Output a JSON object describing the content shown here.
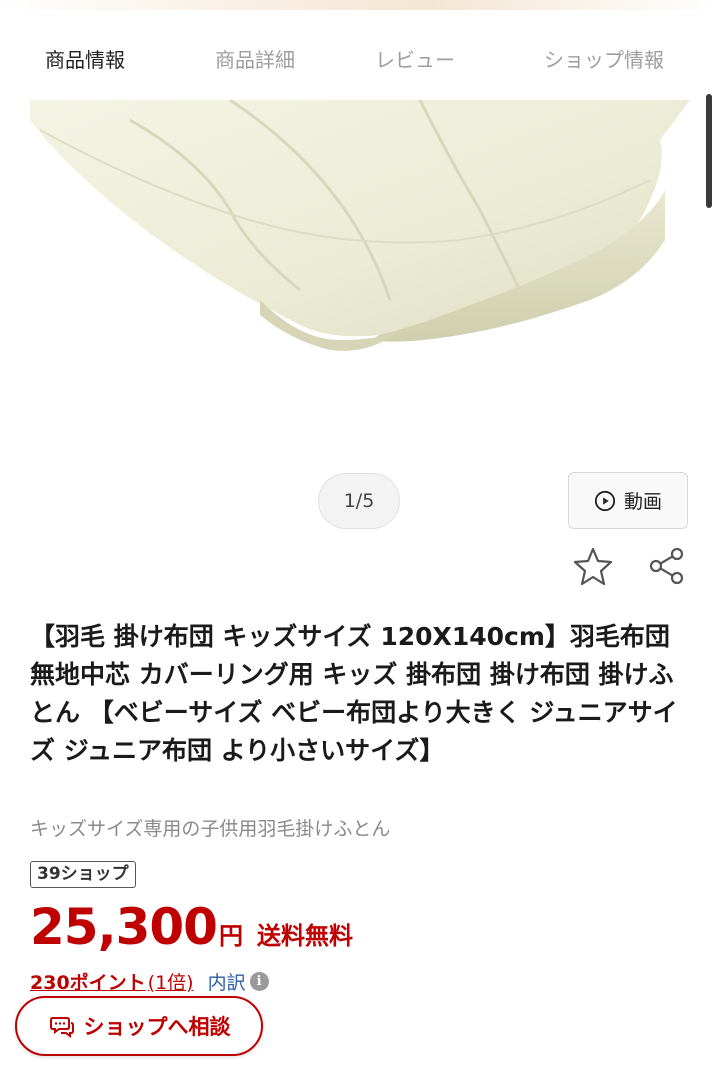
{
  "tabs": [
    {
      "label": "商品情報",
      "active": true
    },
    {
      "label": "商品詳細",
      "active": false
    },
    {
      "label": "レビュー",
      "active": false
    },
    {
      "label": "ショップ情報",
      "active": false
    }
  ],
  "gallery": {
    "counter": "1/5",
    "video_label": "動画",
    "video_icon": "play-circle-icon"
  },
  "actions": {
    "favorite_icon": "star-icon",
    "share_icon": "share-icon"
  },
  "product": {
    "title": "【羽毛 掛け布団 キッズサイズ 120X140cm】羽毛布団 無地中芯 カバーリング用 キッズ 掛布団 掛け布団 掛けふとん 【ベビーサイズ ベビー布団より大きく ジュニアサイズ ジュニア布団 より小さいサイズ】",
    "subtitle": "キッズサイズ専用の子供用羽毛掛けふとん",
    "shop_badge": "39ショップ",
    "price": "25,300",
    "currency": "円",
    "shipping": "送料無料",
    "points": "230ポイント",
    "points_multiplier": "(1倍)",
    "breakdown": "内訳",
    "info_icon": "i"
  },
  "consult": {
    "label": "ショップへ相談",
    "icon": "chat-bubble-icon"
  },
  "colors": {
    "accent_red": "#bf0000",
    "link_blue": "#2b5ea6",
    "muted_text": "#9e9e9e"
  }
}
